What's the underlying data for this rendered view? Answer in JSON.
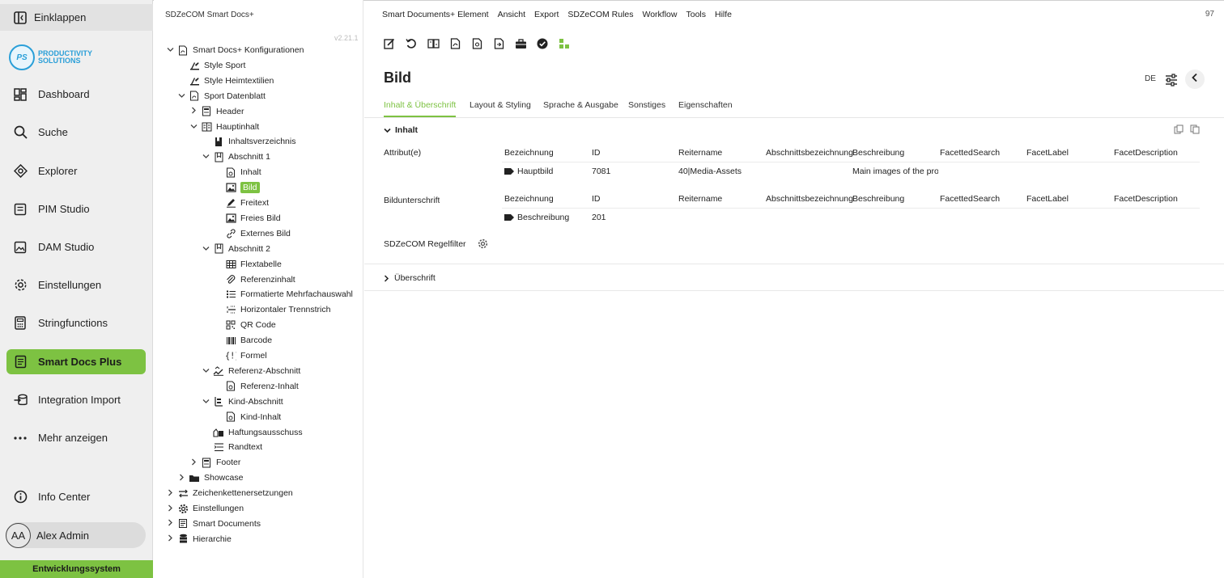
{
  "nav": {
    "collapse": "Einklappen",
    "logo_mark": "PS",
    "logo_line1": "PRODUCTIVITY",
    "logo_line2": "SOLUTIONS",
    "items": [
      {
        "label": "Dashboard",
        "icon": "dashboard-icon"
      },
      {
        "label": "Suche",
        "icon": "search-icon"
      },
      {
        "label": "Explorer",
        "icon": "explorer-icon"
      },
      {
        "label": "PIM Studio",
        "icon": "pim-icon"
      },
      {
        "label": "DAM Studio",
        "icon": "image-icon"
      },
      {
        "label": "Einstellungen",
        "icon": "gear-icon"
      },
      {
        "label": "Stringfunctions",
        "icon": "calculator-icon"
      },
      {
        "label": "Smart Docs Plus",
        "icon": "document-icon"
      },
      {
        "label": "Integration Import",
        "icon": "import-icon"
      },
      {
        "label": "Mehr anzeigen",
        "icon": "more-icon"
      }
    ],
    "info": "Info Center",
    "user_initials": "AA",
    "user_name": "Alex Admin",
    "env": "Entwicklungssystem",
    "accent": "#7dc242"
  },
  "tree": {
    "title": "SDZeCOM Smart Docs+",
    "version": "v2.21.1",
    "nodes": [
      {
        "label": "Smart Docs+ Konfigurationen"
      },
      {
        "label": "Style Sport"
      },
      {
        "label": "Style Heimtextilien"
      },
      {
        "label": "Sport Datenblatt"
      },
      {
        "label": "Header"
      },
      {
        "label": "Hauptinhalt"
      },
      {
        "label": "Inhaltsverzeichnis"
      },
      {
        "label": "Abschnitt 1"
      },
      {
        "label": "Inhalt"
      },
      {
        "label": "Bild"
      },
      {
        "label": "Freitext"
      },
      {
        "label": "Freies Bild"
      },
      {
        "label": "Externes Bild"
      },
      {
        "label": "Abschnitt 2"
      },
      {
        "label": "Flextabelle"
      },
      {
        "label": "Referenzinhalt"
      },
      {
        "label": "Formatierte Mehrfachauswahl"
      },
      {
        "label": "Horizontaler Trennstrich"
      },
      {
        "label": "QR Code"
      },
      {
        "label": "Barcode"
      },
      {
        "label": "Formel"
      },
      {
        "label": "Referenz-Abschnitt"
      },
      {
        "label": "Referenz-Inhalt"
      },
      {
        "label": "Kind-Abschnitt"
      },
      {
        "label": "Kind-Inhalt"
      },
      {
        "label": "Haftungsausschuss"
      },
      {
        "label": "Randtext"
      },
      {
        "label": "Footer"
      },
      {
        "label": "Showcase"
      },
      {
        "label": "Zeichenkettenersetzungen"
      },
      {
        "label": "Einstellungen"
      },
      {
        "label": "Smart Documents"
      },
      {
        "label": "Hierarchie"
      }
    ]
  },
  "main": {
    "menu": [
      "Smart Documents+ Element",
      "Ansicht",
      "Export",
      "SDZeCOM Rules",
      "Workflow",
      "Tools",
      "Hilfe"
    ],
    "page_count": "97",
    "title": "Bild",
    "lang": "DE",
    "tabs": [
      "Inhalt & Überschrift",
      "Layout & Styling",
      "Sprache & Ausgabe",
      "Sonstiges",
      "Eigenschaften"
    ],
    "section_inhalt": "Inhalt",
    "attribute": {
      "label": "Attribut(e)",
      "headers": [
        "Bezeichnung",
        "ID",
        "Reitername",
        "Abschnittsbezeichnung",
        "Beschreibung",
        "FacettedSearch",
        "FacetLabel",
        "FacetDescription"
      ],
      "row": {
        "bezeichnung": "Hauptbild",
        "id": "7081",
        "reiter": "40|Media-Assets",
        "beschreibung": "Main images of the proc"
      }
    },
    "caption": {
      "label": "Bildunterschrift",
      "headers": [
        "Bezeichnung",
        "ID",
        "Reitername",
        "Abschnittsbezeichnung",
        "Beschreibung",
        "FacettedSearch",
        "FacetLabel",
        "FacetDescription"
      ],
      "row": {
        "bezeichnung": "Beschreibung",
        "id": "201"
      }
    },
    "regelfilter": "SDZeCOM Regelfilter",
    "section_ueberschrift": "Überschrift"
  }
}
